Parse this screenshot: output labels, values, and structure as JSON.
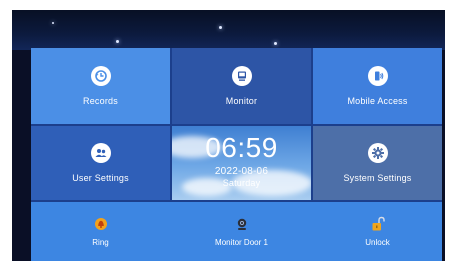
{
  "tiles": {
    "records": {
      "label": "Records",
      "icon": "records-icon"
    },
    "monitor": {
      "label": "Monitor",
      "icon": "monitor-icon"
    },
    "mobile_access": {
      "label": "Mobile Access",
      "icon": "mobile-access-icon"
    },
    "user_settings": {
      "label": "User Settings",
      "icon": "user-settings-icon"
    },
    "system_settings": {
      "label": "System Settings",
      "icon": "gear-icon"
    }
  },
  "clock": {
    "time": "06:59",
    "date": "2022-08-06",
    "day": "Saturday"
  },
  "bottom_bar": {
    "ring": {
      "label": "Ring",
      "icon": "bell-icon"
    },
    "monitor_door": {
      "label": "Monitor Door 1",
      "icon": "camera-icon"
    },
    "unlock": {
      "label": "Unlock",
      "icon": "unlock-icon"
    }
  },
  "colors": {
    "panel": "#1c3f8c",
    "accent": "#3d86e2",
    "screen_bg": "#0a0f26"
  }
}
